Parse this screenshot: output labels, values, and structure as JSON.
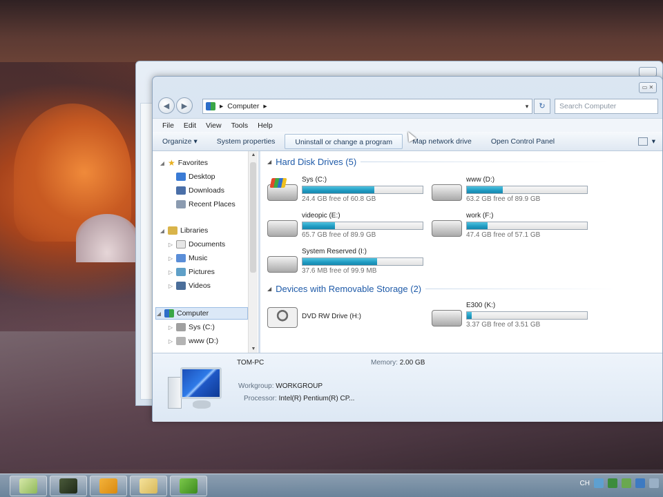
{
  "window": {
    "address_segments": [
      "Computer"
    ],
    "search_placeholder": "Search Computer"
  },
  "menu": [
    "File",
    "Edit",
    "View",
    "Tools",
    "Help"
  ],
  "commands": {
    "organize": "Organize ▾",
    "system_properties": "System properties",
    "uninstall": "Uninstall or change a program",
    "map_drive": "Map network drive",
    "control_panel": "Open Control Panel"
  },
  "nav": {
    "favorites": "Favorites",
    "desktop": "Desktop",
    "downloads": "Downloads",
    "recent": "Recent Places",
    "libraries": "Libraries",
    "documents": "Documents",
    "music": "Music",
    "pictures": "Pictures",
    "videos": "Videos",
    "computer": "Computer",
    "sys": "Sys (C:)",
    "www": "www (D:)"
  },
  "groups": {
    "hard_disks": "Hard Disk Drives (5)",
    "removable": "Devices with Removable Storage (2)"
  },
  "drives": [
    {
      "name": "Sys (C:)",
      "free": "24.4 GB free of 60.8 GB",
      "used_fraction": 0.6,
      "icon": "windows-drive-icon"
    },
    {
      "name": "www (D:)",
      "free": "63.2 GB free of 89.9 GB",
      "used_fraction": 0.3,
      "icon": "hard-drive-icon"
    },
    {
      "name": "videopic (E:)",
      "free": "65.7 GB free of 89.9 GB",
      "used_fraction": 0.27,
      "icon": "hard-drive-icon"
    },
    {
      "name": "work (F:)",
      "free": "47.4 GB free of 57.1 GB",
      "used_fraction": 0.17,
      "icon": "hard-drive-icon"
    },
    {
      "name": "System Reserved (I:)",
      "free": "37.6 MB free of 99.9 MB",
      "used_fraction": 0.62,
      "icon": "hard-drive-icon"
    }
  ],
  "removable": [
    {
      "name": "DVD RW Drive (H:)",
      "icon": "dvd-drive-icon"
    },
    {
      "name": "E300 (K:)",
      "free": "3.37 GB free of 3.51 GB",
      "used_fraction": 0.04,
      "icon": "usb-drive-icon"
    }
  ],
  "details": {
    "pc_name": "TOM-PC",
    "memory_label": "Memory:",
    "memory_value": "2.00 GB",
    "workgroup_label": "Workgroup:",
    "workgroup_value": "WORKGROUP",
    "processor_label": "Processor:",
    "processor_value": "Intel(R) Pentium(R) CP..."
  },
  "taskbar": {
    "items": [
      "explorer-icon",
      "media-icon",
      "amazon-icon",
      "folder-icon",
      "game-icon"
    ],
    "tray_lang": "CH"
  }
}
